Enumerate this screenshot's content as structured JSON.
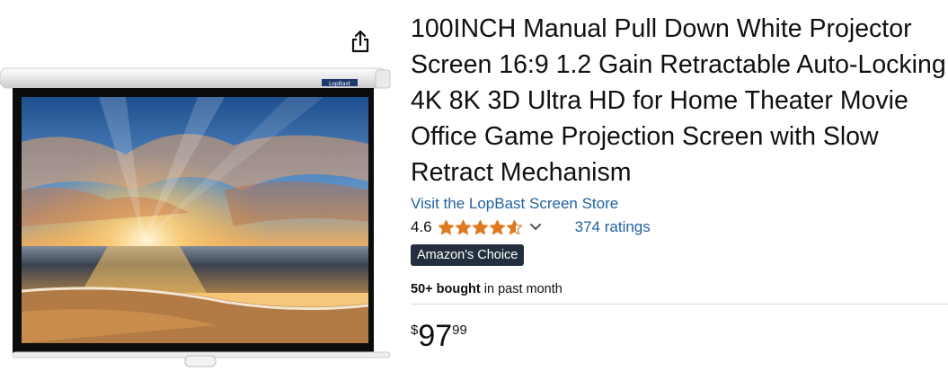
{
  "product": {
    "title": "100INCH Manual Pull Down White Projector Screen 16:9 1.2 Gain Retractable Auto-Locking 4K 8K 3D Ultra HD for Home Theater Movie Office Game Projection Screen with Slow Retract Mechanism",
    "store_link": "Visit the LopBast Screen Store",
    "brand_logo": "LopBast",
    "rating": {
      "value": "4.6",
      "stars": 4.6,
      "count_label": "374 ratings"
    },
    "badge": "Amazon's Choice",
    "bought": {
      "bold": "50+ bought",
      "rest": " in past month"
    },
    "price": {
      "symbol": "$",
      "whole": "97",
      "fraction": "99"
    }
  },
  "icons": {
    "share": "share-icon",
    "star": "star-icon",
    "chevron": "chevron-down-icon"
  },
  "colors": {
    "link": "#2162a1",
    "star": "#de7921",
    "badge_bg": "#232f3e"
  }
}
